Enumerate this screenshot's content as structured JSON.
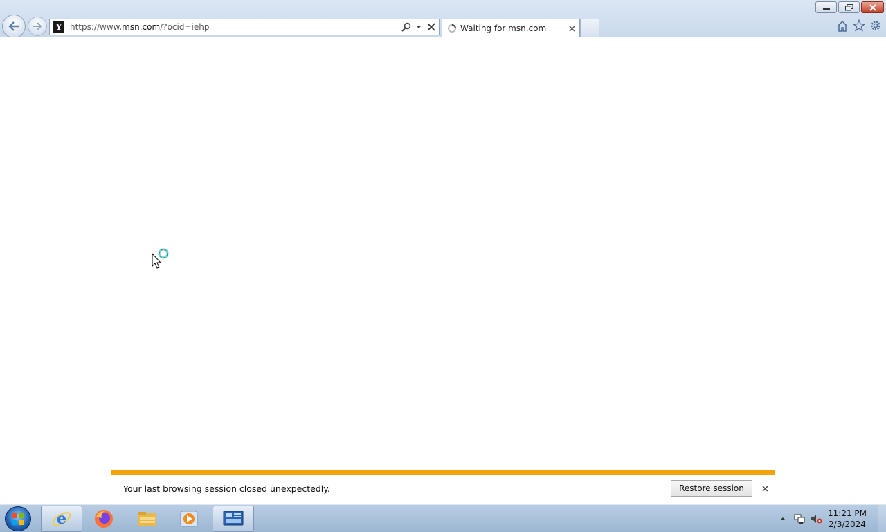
{
  "browser": {
    "address_bar": {
      "url_prefix": "https://www.",
      "url_domain": "msn.com",
      "url_suffix": "/?ocid=iehp",
      "site_icon_letter": "Y"
    },
    "tab": {
      "label": "Waiting for msn.com"
    },
    "window_controls": [
      "minimize",
      "restore",
      "close"
    ],
    "command_icons": [
      "home-icon",
      "favorites-star-icon",
      "tools-gear-icon"
    ]
  },
  "notification": {
    "message": "Your last browsing session closed unexpectedly.",
    "restore_label": "Restore session",
    "accent_color": "#f0a30a"
  },
  "taskbar": {
    "items": [
      {
        "name": "internet-explorer",
        "active": true
      },
      {
        "name": "firefox",
        "active": false
      },
      {
        "name": "file-explorer",
        "active": false
      },
      {
        "name": "media-player",
        "active": false
      },
      {
        "name": "server-manager",
        "active": true
      }
    ],
    "clock": {
      "time": "11:21 PM",
      "date": "2/3/2024"
    }
  }
}
